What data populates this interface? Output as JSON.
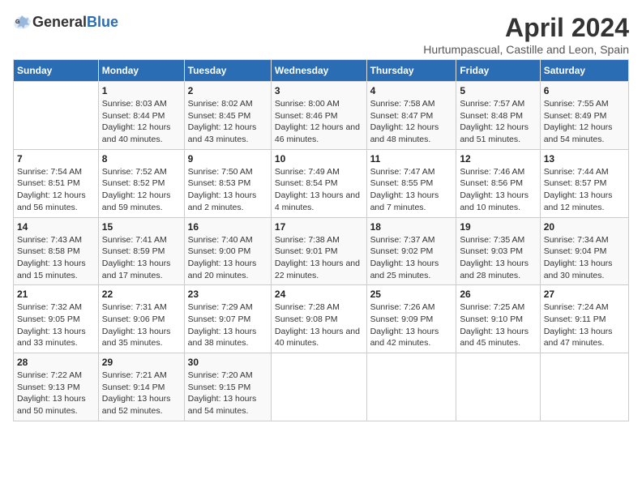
{
  "header": {
    "logo_general": "General",
    "logo_blue": "Blue",
    "title": "April 2024",
    "subtitle": "Hurtumpascual, Castille and Leon, Spain"
  },
  "calendar": {
    "weekdays": [
      "Sunday",
      "Monday",
      "Tuesday",
      "Wednesday",
      "Thursday",
      "Friday",
      "Saturday"
    ],
    "weeks": [
      [
        {
          "day": "",
          "sunrise": "",
          "sunset": "",
          "daylight": ""
        },
        {
          "day": "1",
          "sunrise": "Sunrise: 8:03 AM",
          "sunset": "Sunset: 8:44 PM",
          "daylight": "Daylight: 12 hours and 40 minutes."
        },
        {
          "day": "2",
          "sunrise": "Sunrise: 8:02 AM",
          "sunset": "Sunset: 8:45 PM",
          "daylight": "Daylight: 12 hours and 43 minutes."
        },
        {
          "day": "3",
          "sunrise": "Sunrise: 8:00 AM",
          "sunset": "Sunset: 8:46 PM",
          "daylight": "Daylight: 12 hours and 46 minutes."
        },
        {
          "day": "4",
          "sunrise": "Sunrise: 7:58 AM",
          "sunset": "Sunset: 8:47 PM",
          "daylight": "Daylight: 12 hours and 48 minutes."
        },
        {
          "day": "5",
          "sunrise": "Sunrise: 7:57 AM",
          "sunset": "Sunset: 8:48 PM",
          "daylight": "Daylight: 12 hours and 51 minutes."
        },
        {
          "day": "6",
          "sunrise": "Sunrise: 7:55 AM",
          "sunset": "Sunset: 8:49 PM",
          "daylight": "Daylight: 12 hours and 54 minutes."
        }
      ],
      [
        {
          "day": "7",
          "sunrise": "Sunrise: 7:54 AM",
          "sunset": "Sunset: 8:51 PM",
          "daylight": "Daylight: 12 hours and 56 minutes."
        },
        {
          "day": "8",
          "sunrise": "Sunrise: 7:52 AM",
          "sunset": "Sunset: 8:52 PM",
          "daylight": "Daylight: 12 hours and 59 minutes."
        },
        {
          "day": "9",
          "sunrise": "Sunrise: 7:50 AM",
          "sunset": "Sunset: 8:53 PM",
          "daylight": "Daylight: 13 hours and 2 minutes."
        },
        {
          "day": "10",
          "sunrise": "Sunrise: 7:49 AM",
          "sunset": "Sunset: 8:54 PM",
          "daylight": "Daylight: 13 hours and 4 minutes."
        },
        {
          "day": "11",
          "sunrise": "Sunrise: 7:47 AM",
          "sunset": "Sunset: 8:55 PM",
          "daylight": "Daylight: 13 hours and 7 minutes."
        },
        {
          "day": "12",
          "sunrise": "Sunrise: 7:46 AM",
          "sunset": "Sunset: 8:56 PM",
          "daylight": "Daylight: 13 hours and 10 minutes."
        },
        {
          "day": "13",
          "sunrise": "Sunrise: 7:44 AM",
          "sunset": "Sunset: 8:57 PM",
          "daylight": "Daylight: 13 hours and 12 minutes."
        }
      ],
      [
        {
          "day": "14",
          "sunrise": "Sunrise: 7:43 AM",
          "sunset": "Sunset: 8:58 PM",
          "daylight": "Daylight: 13 hours and 15 minutes."
        },
        {
          "day": "15",
          "sunrise": "Sunrise: 7:41 AM",
          "sunset": "Sunset: 8:59 PM",
          "daylight": "Daylight: 13 hours and 17 minutes."
        },
        {
          "day": "16",
          "sunrise": "Sunrise: 7:40 AM",
          "sunset": "Sunset: 9:00 PM",
          "daylight": "Daylight: 13 hours and 20 minutes."
        },
        {
          "day": "17",
          "sunrise": "Sunrise: 7:38 AM",
          "sunset": "Sunset: 9:01 PM",
          "daylight": "Daylight: 13 hours and 22 minutes."
        },
        {
          "day": "18",
          "sunrise": "Sunrise: 7:37 AM",
          "sunset": "Sunset: 9:02 PM",
          "daylight": "Daylight: 13 hours and 25 minutes."
        },
        {
          "day": "19",
          "sunrise": "Sunrise: 7:35 AM",
          "sunset": "Sunset: 9:03 PM",
          "daylight": "Daylight: 13 hours and 28 minutes."
        },
        {
          "day": "20",
          "sunrise": "Sunrise: 7:34 AM",
          "sunset": "Sunset: 9:04 PM",
          "daylight": "Daylight: 13 hours and 30 minutes."
        }
      ],
      [
        {
          "day": "21",
          "sunrise": "Sunrise: 7:32 AM",
          "sunset": "Sunset: 9:05 PM",
          "daylight": "Daylight: 13 hours and 33 minutes."
        },
        {
          "day": "22",
          "sunrise": "Sunrise: 7:31 AM",
          "sunset": "Sunset: 9:06 PM",
          "daylight": "Daylight: 13 hours and 35 minutes."
        },
        {
          "day": "23",
          "sunrise": "Sunrise: 7:29 AM",
          "sunset": "Sunset: 9:07 PM",
          "daylight": "Daylight: 13 hours and 38 minutes."
        },
        {
          "day": "24",
          "sunrise": "Sunrise: 7:28 AM",
          "sunset": "Sunset: 9:08 PM",
          "daylight": "Daylight: 13 hours and 40 minutes."
        },
        {
          "day": "25",
          "sunrise": "Sunrise: 7:26 AM",
          "sunset": "Sunset: 9:09 PM",
          "daylight": "Daylight: 13 hours and 42 minutes."
        },
        {
          "day": "26",
          "sunrise": "Sunrise: 7:25 AM",
          "sunset": "Sunset: 9:10 PM",
          "daylight": "Daylight: 13 hours and 45 minutes."
        },
        {
          "day": "27",
          "sunrise": "Sunrise: 7:24 AM",
          "sunset": "Sunset: 9:11 PM",
          "daylight": "Daylight: 13 hours and 47 minutes."
        }
      ],
      [
        {
          "day": "28",
          "sunrise": "Sunrise: 7:22 AM",
          "sunset": "Sunset: 9:13 PM",
          "daylight": "Daylight: 13 hours and 50 minutes."
        },
        {
          "day": "29",
          "sunrise": "Sunrise: 7:21 AM",
          "sunset": "Sunset: 9:14 PM",
          "daylight": "Daylight: 13 hours and 52 minutes."
        },
        {
          "day": "30",
          "sunrise": "Sunrise: 7:20 AM",
          "sunset": "Sunset: 9:15 PM",
          "daylight": "Daylight: 13 hours and 54 minutes."
        },
        {
          "day": "",
          "sunrise": "",
          "sunset": "",
          "daylight": ""
        },
        {
          "day": "",
          "sunrise": "",
          "sunset": "",
          "daylight": ""
        },
        {
          "day": "",
          "sunrise": "",
          "sunset": "",
          "daylight": ""
        },
        {
          "day": "",
          "sunrise": "",
          "sunset": "",
          "daylight": ""
        }
      ]
    ]
  }
}
